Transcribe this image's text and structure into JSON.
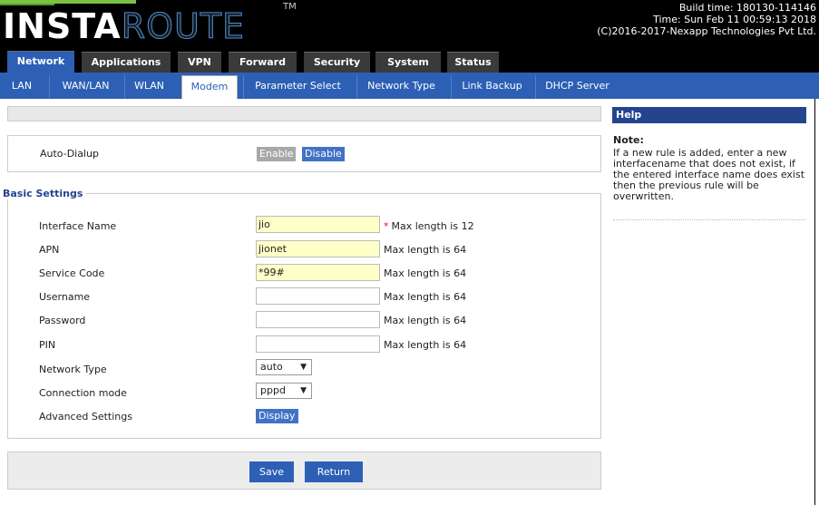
{
  "header": {
    "logo_left": "INSTA",
    "logo_right": "ROUTE",
    "tm": "TM",
    "build_time": "Build time: 180130-114146",
    "time": "Time: Sun Feb 11 00:59:13 2018",
    "copyright": "(C)2016-2017-Nexapp Technologies Pvt Ltd."
  },
  "main_tabs": [
    "Network",
    "Applications",
    "VPN",
    "Forward",
    "Security",
    "System",
    "Status"
  ],
  "sub_tabs": [
    "LAN",
    "WAN/LAN",
    "WLAN",
    "Modem",
    "Parameter Select",
    "Network Type",
    "Link Backup",
    "DHCP Server"
  ],
  "auto_dialup": {
    "label": "Auto-Dialup",
    "enable": "Enable",
    "disable": "Disable"
  },
  "basic_settings": {
    "legend": "Basic Settings",
    "interface_name": {
      "label": "Interface Name",
      "value": "jio",
      "hint": "Max length is 12",
      "required": "*"
    },
    "apn": {
      "label": "APN",
      "value": "jionet",
      "hint": "Max length is 64"
    },
    "service_code": {
      "label": "Service Code",
      "value": "*99#",
      "hint": "Max length is 64"
    },
    "username": {
      "label": "Username",
      "value": "",
      "hint": "Max length is 64"
    },
    "password": {
      "label": "Password",
      "value": "",
      "hint": "Max length is 64"
    },
    "pin": {
      "label": "PIN",
      "value": "",
      "hint": "Max length is 64"
    },
    "network_type": {
      "label": "Network Type",
      "value": "auto"
    },
    "connection_mode": {
      "label": "Connection mode",
      "value": "pppd"
    },
    "advanced": {
      "label": "Advanced Settings",
      "button": "Display"
    }
  },
  "actions": {
    "save": "Save",
    "return": "Return"
  },
  "help": {
    "title": "Help",
    "note_label": "Note:",
    "note_text": "If a new rule is added, enter a new interfacename that does not exist, if the entered interface name does exist then the previous rule will be overwritten."
  },
  "colors": {
    "accent": "#2d5fb5",
    "help_header": "#24448e",
    "filled_field": "#ffffc8",
    "header_bg": "#000000"
  }
}
